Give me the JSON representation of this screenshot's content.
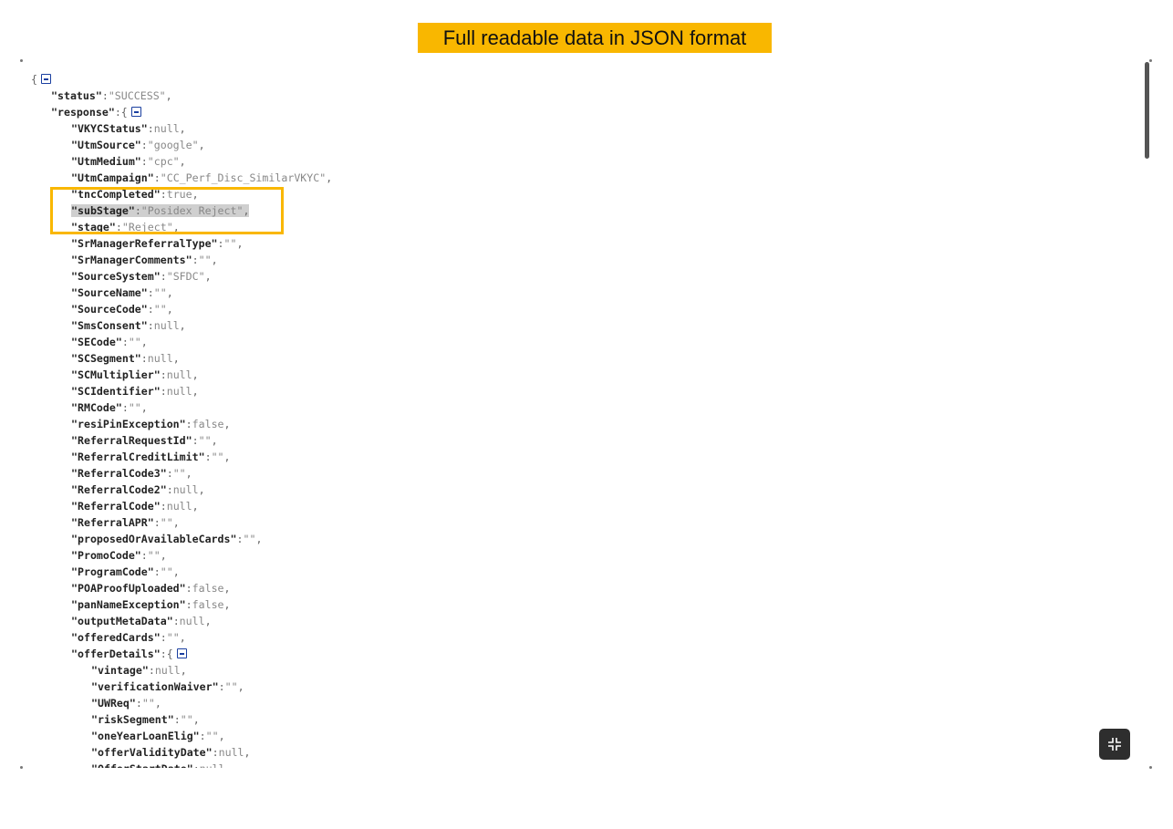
{
  "banner": {
    "title": "Full readable data in JSON format"
  },
  "viewer": {
    "collapse_icon": "collapse-icon",
    "toggle_icon": "collapse-node-icon",
    "highlight_color": "#f9b700",
    "lines": [
      {
        "indent": 0,
        "key": null,
        "open": "{",
        "toggle": true
      },
      {
        "indent": 1,
        "key": "status",
        "value": "\"SUCCESS\"",
        "comma": true
      },
      {
        "indent": 1,
        "key": "response",
        "open": "{",
        "toggle": true
      },
      {
        "indent": 2,
        "key": "VKYCStatus",
        "value": "null",
        "comma": true
      },
      {
        "indent": 2,
        "key": "UtmSource",
        "value": "\"google\"",
        "comma": true
      },
      {
        "indent": 2,
        "key": "UtmMedium",
        "value": "\"cpc\"",
        "comma": true
      },
      {
        "indent": 2,
        "key": "UtmCampaign",
        "value": "\"CC_Perf_Disc_SimilarVKYC\"",
        "comma": true
      },
      {
        "indent": 2,
        "key": "tncCompleted",
        "value": "true",
        "comma": true
      },
      {
        "indent": 2,
        "key": "subStage",
        "value": "\"Posidex Reject\"",
        "comma": true,
        "selected": true
      },
      {
        "indent": 2,
        "key": "stage",
        "value": "\"Reject\"",
        "comma": true
      },
      {
        "indent": 2,
        "key": "SrManagerReferralType",
        "value": "\"\"",
        "comma": true
      },
      {
        "indent": 2,
        "key": "SrManagerComments",
        "value": "\"\"",
        "comma": true
      },
      {
        "indent": 2,
        "key": "SourceSystem",
        "value": "\"SFDC\"",
        "comma": true
      },
      {
        "indent": 2,
        "key": "SourceName",
        "value": "\"\"",
        "comma": true
      },
      {
        "indent": 2,
        "key": "SourceCode",
        "value": "\"\"",
        "comma": true
      },
      {
        "indent": 2,
        "key": "SmsConsent",
        "value": "null",
        "comma": true
      },
      {
        "indent": 2,
        "key": "SECode",
        "value": "\"\"",
        "comma": true
      },
      {
        "indent": 2,
        "key": "SCSegment",
        "value": "null",
        "comma": true
      },
      {
        "indent": 2,
        "key": "SCMultiplier",
        "value": "null",
        "comma": true
      },
      {
        "indent": 2,
        "key": "SCIdentifier",
        "value": "null",
        "comma": true
      },
      {
        "indent": 2,
        "key": "RMCode",
        "value": "\"\"",
        "comma": true
      },
      {
        "indent": 2,
        "key": "resiPinException",
        "value": "false",
        "comma": true
      },
      {
        "indent": 2,
        "key": "ReferralRequestId",
        "value": "\"\"",
        "comma": true
      },
      {
        "indent": 2,
        "key": "ReferralCreditLimit",
        "value": "\"\"",
        "comma": true
      },
      {
        "indent": 2,
        "key": "ReferralCode3",
        "value": "\"\"",
        "comma": true
      },
      {
        "indent": 2,
        "key": "ReferralCode2",
        "value": "null",
        "comma": true
      },
      {
        "indent": 2,
        "key": "ReferralCode",
        "value": "null",
        "comma": true
      },
      {
        "indent": 2,
        "key": "ReferralAPR",
        "value": "\"\"",
        "comma": true
      },
      {
        "indent": 2,
        "key": "proposedOrAvailableCards",
        "value": "\"\"",
        "comma": true
      },
      {
        "indent": 2,
        "key": "PromoCode",
        "value": "\"\"",
        "comma": true
      },
      {
        "indent": 2,
        "key": "ProgramCode",
        "value": "\"\"",
        "comma": true
      },
      {
        "indent": 2,
        "key": "POAProofUploaded",
        "value": "false",
        "comma": true
      },
      {
        "indent": 2,
        "key": "panNameException",
        "value": "false",
        "comma": true
      },
      {
        "indent": 2,
        "key": "outputMetaData",
        "value": "null",
        "comma": true
      },
      {
        "indent": 2,
        "key": "offeredCards",
        "value": "\"\"",
        "comma": true
      },
      {
        "indent": 2,
        "key": "offerDetails",
        "open": "{",
        "toggle": true
      },
      {
        "indent": 3,
        "key": "vintage",
        "value": "null",
        "comma": true
      },
      {
        "indent": 3,
        "key": "verificationWaiver",
        "value": "\"\"",
        "comma": true
      },
      {
        "indent": 3,
        "key": "UWReq",
        "value": "\"\"",
        "comma": true
      },
      {
        "indent": 3,
        "key": "riskSegment",
        "value": "\"\"",
        "comma": true
      },
      {
        "indent": 3,
        "key": "oneYearLoanElig",
        "value": "\"\"",
        "comma": true
      },
      {
        "indent": 3,
        "key": "offerValidityDate",
        "value": "null",
        "comma": true
      },
      {
        "indent": 3,
        "key": "OfferStartDate",
        "value": "null",
        "comma": true
      }
    ]
  }
}
